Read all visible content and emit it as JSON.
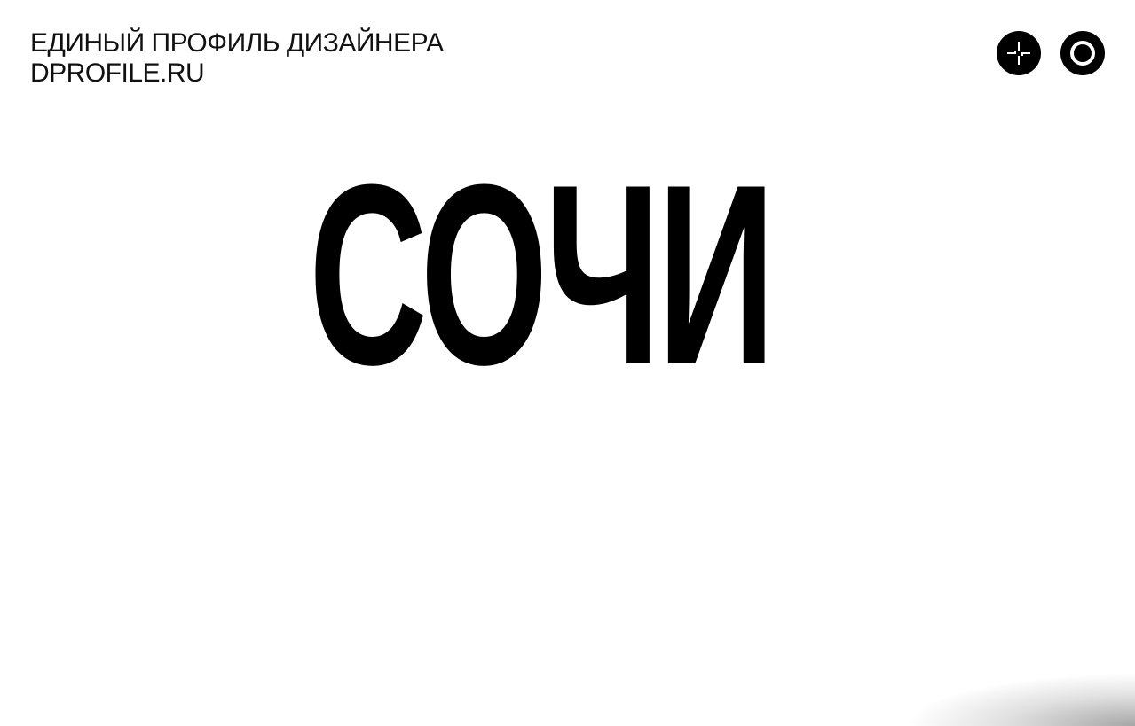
{
  "header": {
    "title_line1": "ЕДИНЫЙ ПРОФИЛЬ ДИЗАЙНЕРА",
    "title_line2": "DPROFILE.RU"
  },
  "toolbar": {
    "buttons": [
      {
        "icon": "sparkle-crosshair-icon"
      },
      {
        "icon": "ring-icon"
      }
    ]
  },
  "hero": {
    "title": "СОЧИ"
  },
  "colors": {
    "background": "#ffffff",
    "text": "#000000"
  }
}
